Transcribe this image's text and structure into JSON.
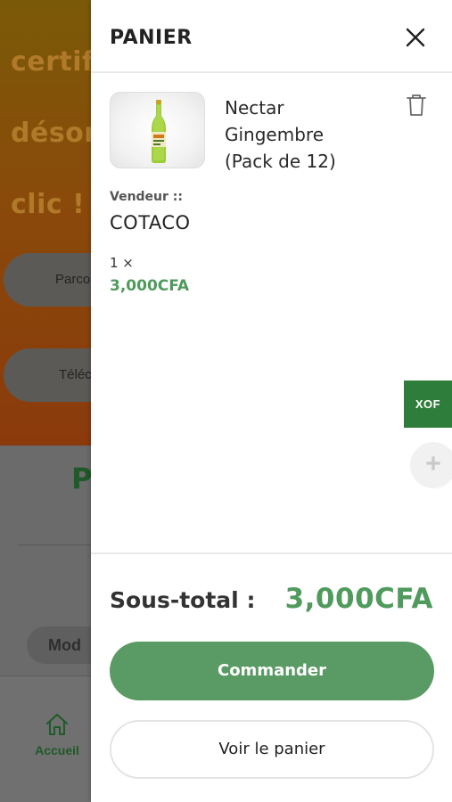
{
  "background": {
    "hero_lines": [
      "certif",
      "désor",
      "clic !"
    ],
    "pill_buttons": [
      "Parco",
      "Téléc"
    ],
    "section_heading": "P",
    "mode_pill": "Mod",
    "bottom_nav": {
      "home_label": "Accueil",
      "home_icon": "home-icon"
    }
  },
  "cart": {
    "title": "PANIER",
    "close_icon": "close-icon",
    "items": [
      {
        "name_lines": [
          "Nectar",
          "Gingembre",
          "(Pack de 12)"
        ],
        "image": "bottle-image",
        "vendor_label": "Vendeur ::",
        "vendor_name": "COTACO",
        "quantity": "1 ×",
        "price": "3,000CFA",
        "delete_icon": "trash-icon"
      }
    ],
    "currency_switch": "XOF",
    "add_button": "+",
    "subtotal_label": "Sous-total :",
    "subtotal_value": "3,000CFA",
    "checkout_label": "Commander",
    "view_cart_label": "Voir le panier"
  },
  "colors": {
    "accent_green": "#4f9a5c",
    "button_green": "#5a9a64",
    "currency_green": "#2f7d3a",
    "overlay_brown": "#8b3a0c"
  }
}
